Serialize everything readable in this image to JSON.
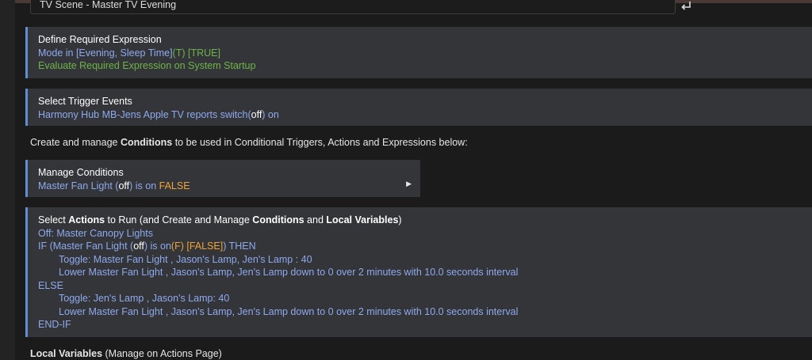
{
  "name_input": {
    "value": "TV Scene - Master TV Evening"
  },
  "required_expression": {
    "title": "Define Required Expression",
    "line1_a": "Mode in [Evening, Sleep Time]",
    "line1_b": "(T) [TRUE]",
    "line2": "Evaluate Required Expression on System Startup"
  },
  "trigger_events": {
    "title": "Select Trigger Events",
    "event_a": "Harmony Hub MB-Jens Apple TV reports switch(",
    "event_state": "off",
    "event_b": ") on"
  },
  "conditions_intro": {
    "text_a": "Create and manage ",
    "text_bold": "Conditions",
    "text_b": " to be used in Conditional Triggers, Actions and Expressions below:"
  },
  "manage_conditions": {
    "title": "Manage Conditions",
    "cond_a": "Master Fan Light (",
    "cond_state": "off",
    "cond_b": ") is on ",
    "cond_result": "FALSE"
  },
  "actions": {
    "title_a": "Select ",
    "title_bold1": "Actions",
    "title_b": " to Run (and Create and Manage ",
    "title_bold2": "Conditions",
    "title_c": " and ",
    "title_bold3": "Local Variables",
    "title_d": ")",
    "line_off": "Off: Master Canopy Lights",
    "if_a": "IF (Master Fan Light (",
    "if_state": "off",
    "if_b": ") is on",
    "if_result": "(F) [FALSE]",
    "if_c": ") THEN",
    "toggle1": "Toggle: Master Fan Light , Jason's Lamp, Jen's Lamp : 40",
    "lower1": "Lower Master Fan Light , Jason's Lamp, Jen's Lamp  down to 0 over 2 minutes with 10.0 seconds interval",
    "else": "ELSE",
    "toggle2": "Toggle: Jen's Lamp , Jason's Lamp: 40",
    "lower2": "Lower Master Fan Light , Jason's Lamp, Jen's Lamp  down to 0 over 2 minutes with 10.0 seconds interval",
    "endif": "END-IF"
  },
  "local_variables": {
    "text_bold": "Local Variables",
    "text_b": " (Manage on Actions Page)"
  },
  "colors": {
    "accent": "#5c8fd6",
    "link_blue": "#8fa9ee",
    "true_green": "#6fb34a",
    "false_orange": "#f0a33a"
  }
}
